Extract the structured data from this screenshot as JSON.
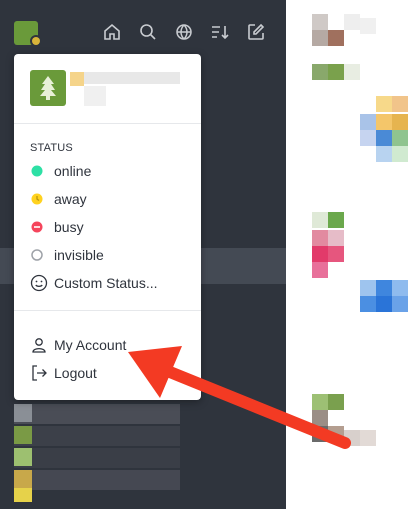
{
  "topbar": {
    "icons": [
      "home-icon",
      "search-icon",
      "directory-icon",
      "sort-icon",
      "compose-icon"
    ]
  },
  "menu": {
    "status_title": "STATUS",
    "statuses": [
      {
        "label": "online",
        "color": "#2de0a5"
      },
      {
        "label": "away",
        "color": "#ffd21f"
      },
      {
        "label": "busy",
        "color": "#f5455c"
      },
      {
        "label": "invisible",
        "color": "#cbced1"
      }
    ],
    "custom_status": "Custom Status...",
    "my_account": "My Account",
    "logout": "Logout"
  },
  "colors": {
    "sidebar_bg": "#2f343d",
    "arrow": "#f33a23"
  }
}
